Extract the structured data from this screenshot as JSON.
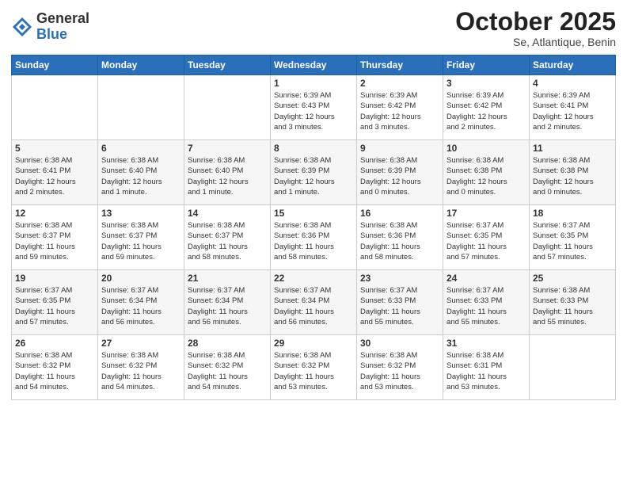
{
  "logo": {
    "general": "General",
    "blue": "Blue"
  },
  "title": "October 2025",
  "subtitle": "Se, Atlantique, Benin",
  "header_days": [
    "Sunday",
    "Monday",
    "Tuesday",
    "Wednesday",
    "Thursday",
    "Friday",
    "Saturday"
  ],
  "weeks": [
    [
      {
        "day": "",
        "info": ""
      },
      {
        "day": "",
        "info": ""
      },
      {
        "day": "",
        "info": ""
      },
      {
        "day": "1",
        "info": "Sunrise: 6:39 AM\nSunset: 6:43 PM\nDaylight: 12 hours\nand 3 minutes."
      },
      {
        "day": "2",
        "info": "Sunrise: 6:39 AM\nSunset: 6:42 PM\nDaylight: 12 hours\nand 3 minutes."
      },
      {
        "day": "3",
        "info": "Sunrise: 6:39 AM\nSunset: 6:42 PM\nDaylight: 12 hours\nand 2 minutes."
      },
      {
        "day": "4",
        "info": "Sunrise: 6:39 AM\nSunset: 6:41 PM\nDaylight: 12 hours\nand 2 minutes."
      }
    ],
    [
      {
        "day": "5",
        "info": "Sunrise: 6:38 AM\nSunset: 6:41 PM\nDaylight: 12 hours\nand 2 minutes."
      },
      {
        "day": "6",
        "info": "Sunrise: 6:38 AM\nSunset: 6:40 PM\nDaylight: 12 hours\nand 1 minute."
      },
      {
        "day": "7",
        "info": "Sunrise: 6:38 AM\nSunset: 6:40 PM\nDaylight: 12 hours\nand 1 minute."
      },
      {
        "day": "8",
        "info": "Sunrise: 6:38 AM\nSunset: 6:39 PM\nDaylight: 12 hours\nand 1 minute."
      },
      {
        "day": "9",
        "info": "Sunrise: 6:38 AM\nSunset: 6:39 PM\nDaylight: 12 hours\nand 0 minutes."
      },
      {
        "day": "10",
        "info": "Sunrise: 6:38 AM\nSunset: 6:38 PM\nDaylight: 12 hours\nand 0 minutes."
      },
      {
        "day": "11",
        "info": "Sunrise: 6:38 AM\nSunset: 6:38 PM\nDaylight: 12 hours\nand 0 minutes."
      }
    ],
    [
      {
        "day": "12",
        "info": "Sunrise: 6:38 AM\nSunset: 6:37 PM\nDaylight: 11 hours\nand 59 minutes."
      },
      {
        "day": "13",
        "info": "Sunrise: 6:38 AM\nSunset: 6:37 PM\nDaylight: 11 hours\nand 59 minutes."
      },
      {
        "day": "14",
        "info": "Sunrise: 6:38 AM\nSunset: 6:37 PM\nDaylight: 11 hours\nand 58 minutes."
      },
      {
        "day": "15",
        "info": "Sunrise: 6:38 AM\nSunset: 6:36 PM\nDaylight: 11 hours\nand 58 minutes."
      },
      {
        "day": "16",
        "info": "Sunrise: 6:38 AM\nSunset: 6:36 PM\nDaylight: 11 hours\nand 58 minutes."
      },
      {
        "day": "17",
        "info": "Sunrise: 6:37 AM\nSunset: 6:35 PM\nDaylight: 11 hours\nand 57 minutes."
      },
      {
        "day": "18",
        "info": "Sunrise: 6:37 AM\nSunset: 6:35 PM\nDaylight: 11 hours\nand 57 minutes."
      }
    ],
    [
      {
        "day": "19",
        "info": "Sunrise: 6:37 AM\nSunset: 6:35 PM\nDaylight: 11 hours\nand 57 minutes."
      },
      {
        "day": "20",
        "info": "Sunrise: 6:37 AM\nSunset: 6:34 PM\nDaylight: 11 hours\nand 56 minutes."
      },
      {
        "day": "21",
        "info": "Sunrise: 6:37 AM\nSunset: 6:34 PM\nDaylight: 11 hours\nand 56 minutes."
      },
      {
        "day": "22",
        "info": "Sunrise: 6:37 AM\nSunset: 6:34 PM\nDaylight: 11 hours\nand 56 minutes."
      },
      {
        "day": "23",
        "info": "Sunrise: 6:37 AM\nSunset: 6:33 PM\nDaylight: 11 hours\nand 55 minutes."
      },
      {
        "day": "24",
        "info": "Sunrise: 6:37 AM\nSunset: 6:33 PM\nDaylight: 11 hours\nand 55 minutes."
      },
      {
        "day": "25",
        "info": "Sunrise: 6:38 AM\nSunset: 6:33 PM\nDaylight: 11 hours\nand 55 minutes."
      }
    ],
    [
      {
        "day": "26",
        "info": "Sunrise: 6:38 AM\nSunset: 6:32 PM\nDaylight: 11 hours\nand 54 minutes."
      },
      {
        "day": "27",
        "info": "Sunrise: 6:38 AM\nSunset: 6:32 PM\nDaylight: 11 hours\nand 54 minutes."
      },
      {
        "day": "28",
        "info": "Sunrise: 6:38 AM\nSunset: 6:32 PM\nDaylight: 11 hours\nand 54 minutes."
      },
      {
        "day": "29",
        "info": "Sunrise: 6:38 AM\nSunset: 6:32 PM\nDaylight: 11 hours\nand 53 minutes."
      },
      {
        "day": "30",
        "info": "Sunrise: 6:38 AM\nSunset: 6:32 PM\nDaylight: 11 hours\nand 53 minutes."
      },
      {
        "day": "31",
        "info": "Sunrise: 6:38 AM\nSunset: 6:31 PM\nDaylight: 11 hours\nand 53 minutes."
      },
      {
        "day": "",
        "info": ""
      }
    ]
  ]
}
